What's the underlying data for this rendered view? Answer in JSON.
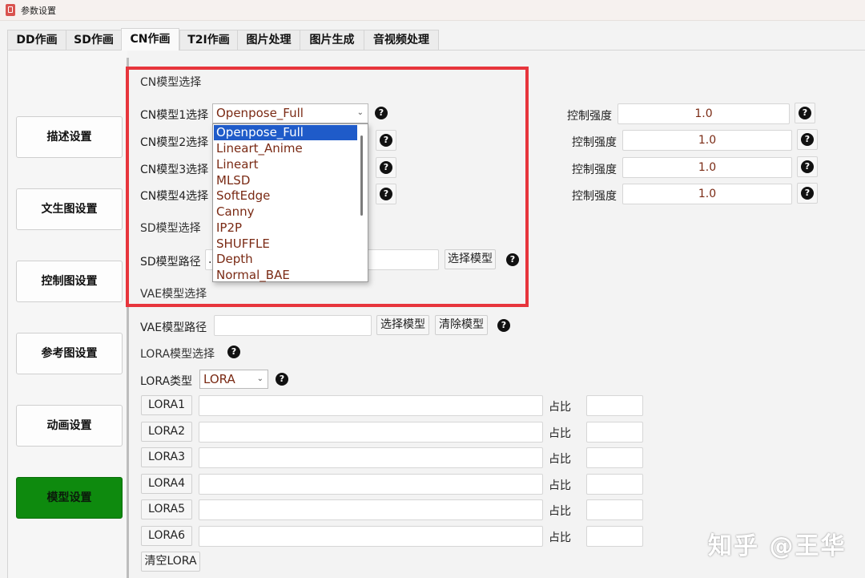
{
  "window": {
    "title": "参数设置"
  },
  "tabs": [
    "DD作画",
    "SD作画",
    "CN作画",
    "T2I作画",
    "图片处理",
    "图片生成",
    "音视频处理"
  ],
  "active_tab": "CN作画",
  "sidebar": {
    "items": [
      "描述设置",
      "文生图设置",
      "控制图设置",
      "参考图设置",
      "动画设置",
      "模型设置"
    ],
    "active": "模型设置",
    "active_color": "#0e8a0e"
  },
  "cn": {
    "section_title": "CN模型选择",
    "rows": [
      {
        "label": "CN模型1选择",
        "value": "Openpose_Full",
        "strength_label": "控制强度",
        "strength": "1.0"
      },
      {
        "label": "CN模型2选择",
        "value": "",
        "strength_label": "控制强度",
        "strength": "1.0"
      },
      {
        "label": "CN模型3选择",
        "value": "",
        "strength_label": "控制强度",
        "strength": "1.0"
      },
      {
        "label": "CN模型4选择",
        "value": "",
        "strength_label": "控制强度",
        "strength": "1.0"
      }
    ],
    "dropdown_options": [
      "Openpose_Full",
      "Lineart_Anime",
      "Lineart",
      "MLSD",
      "SoftEdge",
      "Canny",
      "IP2P",
      "SHUFFLE",
      "Depth",
      "Normal_BAE"
    ],
    "dropdown_selected": "Openpose_Full"
  },
  "sd": {
    "section_title": "SD模型选择",
    "path_label": "SD模型路径",
    "path_value": ".",
    "select_button": "选择模型"
  },
  "vae": {
    "section_title": "VAE模型选择",
    "path_label": "VAE模型路径",
    "path_value": "",
    "select_button": "选择模型",
    "clear_button": "清除模型"
  },
  "lora": {
    "section_title": "LORA模型选择",
    "type_label": "LORA类型",
    "type_value": "LORA",
    "ratio_label": "占比",
    "slots": [
      {
        "name": "LORA1",
        "value": "",
        "ratio": ""
      },
      {
        "name": "LORA2",
        "value": "",
        "ratio": ""
      },
      {
        "name": "LORA3",
        "value": "",
        "ratio": ""
      },
      {
        "name": "LORA4",
        "value": "",
        "ratio": ""
      },
      {
        "name": "LORA5",
        "value": "",
        "ratio": ""
      },
      {
        "name": "LORA6",
        "value": "",
        "ratio": ""
      }
    ],
    "clear_button": "清空LORA"
  },
  "icons": {
    "help": "question-mark-icon",
    "chevron": "chevron-down-icon",
    "app": "app-icon"
  },
  "help_glyph": "?",
  "highlight_color": "#e7353c",
  "watermark": "知乎 @王华"
}
